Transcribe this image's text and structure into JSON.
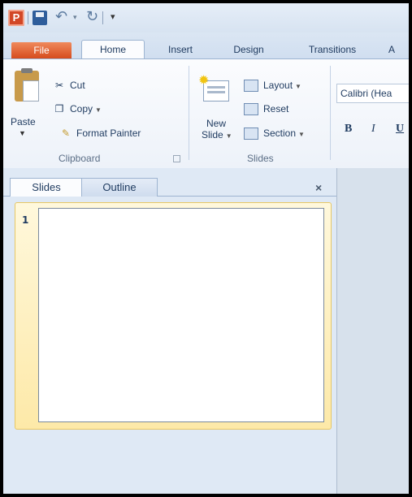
{
  "window": {
    "app_icon_letter": "P"
  },
  "qat": {
    "save_icon": "save-icon",
    "undo_icon": "undo-icon",
    "redo_icon": "redo-icon",
    "customize_icon": "customize-icon"
  },
  "tabs": {
    "file": "File",
    "home": "Home",
    "insert": "Insert",
    "design": "Design",
    "transitions": "Transitions",
    "partial": "A"
  },
  "clipboard": {
    "paste": "Paste",
    "cut": "Cut",
    "copy": "Copy",
    "format_painter": "Format Painter",
    "label": "Clipboard"
  },
  "slides_group": {
    "new_slide_line1": "New",
    "new_slide_line2": "Slide",
    "layout": "Layout",
    "reset": "Reset",
    "section": "Section",
    "label": "Slides"
  },
  "font": {
    "font_name": "Calibri (Hea",
    "bold": "B",
    "italic": "I",
    "underline": "U"
  },
  "panel": {
    "tab_slides": "Slides",
    "tab_outline": "Outline",
    "close": "×",
    "slide_number": "1"
  },
  "colors": {
    "file_tab": "#d64b1d",
    "selection": "#fde9a8",
    "ribbon_bg": "#fbfcfe"
  }
}
